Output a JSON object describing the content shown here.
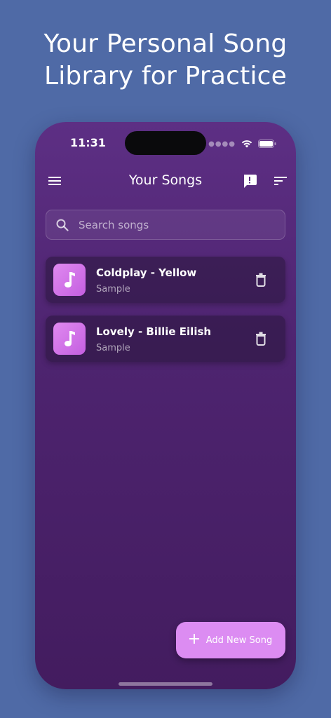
{
  "headline": {
    "line1": "Your Personal Song",
    "line2": "Library for Practice"
  },
  "status_bar": {
    "time": "11:31"
  },
  "appbar": {
    "title": "Your Songs",
    "icons": [
      "menu-icon",
      "feedback-icon",
      "sort-icon"
    ]
  },
  "search": {
    "placeholder": "Search songs",
    "value": ""
  },
  "songs": [
    {
      "title": "Coldplay - Yellow",
      "subtitle": "Sample"
    },
    {
      "title": "Lovely - Billie Eilish",
      "subtitle": "Sample"
    }
  ],
  "fab": {
    "label": "Add New Song"
  },
  "colors": {
    "background": "#4f6aa6",
    "phone_top": "#5d2f84",
    "phone_bottom": "#431c5f",
    "accent": "#dc8cf2"
  }
}
